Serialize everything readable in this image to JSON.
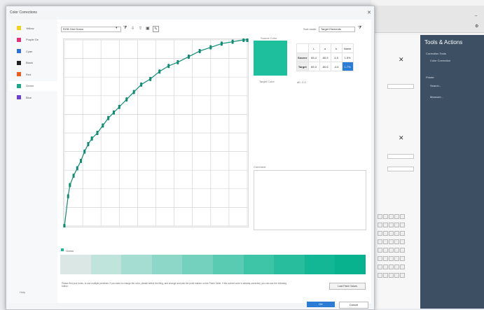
{
  "dialog": {
    "title": "Color Corrections"
  },
  "sidebar": {
    "items": [
      {
        "label": "Yellow",
        "color": "#f2d21b"
      },
      {
        "label": "Purple Ge",
        "color": "#e0337a"
      },
      {
        "label": "Cyan",
        "color": "#2f6fd6"
      },
      {
        "label": "Black",
        "color": "#222222"
      },
      {
        "label": "Red",
        "color": "#ef5a1e"
      },
      {
        "label": "Green",
        "color": "#1aa888"
      },
      {
        "label": "Blue",
        "color": "#6a3fd0"
      }
    ],
    "selected_index": 5,
    "help_label": "Help"
  },
  "toolbar": {
    "profile_value": "RGB Gist Green",
    "sort_label": "Sort mode",
    "sort_value": "Target Elements",
    "icons": [
      "filter-icon",
      "import-icon",
      "export-icon",
      "save-icon",
      "edit-icon"
    ]
  },
  "chart_data": {
    "type": "line",
    "x": [
      0,
      2,
      3,
      5,
      7,
      9,
      11,
      13,
      15,
      18,
      21,
      24,
      27,
      30,
      34,
      38,
      42,
      47,
      52,
      57,
      62,
      68,
      74,
      80,
      86,
      92,
      98,
      100
    ],
    "y": [
      0,
      16,
      22,
      27,
      31,
      35,
      40,
      44,
      47,
      50,
      54,
      58,
      61,
      64,
      68,
      72,
      76,
      79,
      83,
      86,
      88,
      91,
      94,
      96,
      98,
      99,
      100,
      100
    ],
    "xlim": [
      0,
      100
    ],
    "ylim": [
      0,
      100
    ],
    "grid": true,
    "title": "",
    "xlabel": "",
    "ylabel": ""
  },
  "source": {
    "label": "Source Color",
    "color": "#1dbf9d",
    "target_label": "Target Color",
    "delta_label": "dE: 0.0"
  },
  "lab_table": {
    "headers": [
      "",
      "L",
      "a",
      "b",
      "Name"
    ],
    "rows": [
      {
        "name": "Source",
        "L": "65.4",
        "a": "-60.5",
        "b": "4.5",
        "extra": "1.5%"
      },
      {
        "name": "Target",
        "L": "65.3",
        "a": "-60.6",
        "b": "-4.6",
        "extra": "1.7%"
      }
    ]
  },
  "comment": {
    "label": "Comment"
  },
  "gradient": {
    "label": "Green",
    "stops": [
      "#dbe7e5",
      "#bfe4dc",
      "#a6ddd2",
      "#8dd7c8",
      "#73d1bd",
      "#58cbb2",
      "#3ec4a7",
      "#27bd9d",
      "#14b795",
      "#08b28f"
    ]
  },
  "info_text": "Please first pick tones, to use multiple previews. If you want to change the color, please select the tiling, and change and pick the point marker on the Patch Table. If the current color is already corrected, you can use the following button.",
  "buttons": {
    "load": "Load Patch Values",
    "ok": "OK",
    "cancel": "Cancel"
  },
  "app": {
    "tools_title": "Tools & Actions",
    "tools_items": [
      "Correction Tools",
      "Color Correction",
      "Printer",
      "Search...",
      "Measure..."
    ]
  }
}
